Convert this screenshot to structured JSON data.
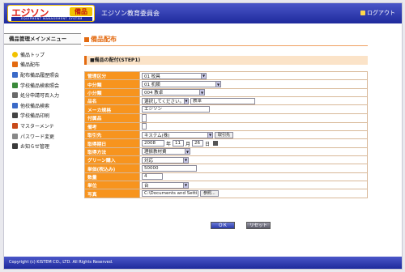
{
  "header": {
    "logo_text": "エジソン",
    "logo_badge": "備品",
    "logo_sub": "EQUIPMENT MANAGEMENT SYSTEM",
    "org_title": "エジソン教育委員会",
    "logout_label": "ログアウト"
  },
  "sidebar": {
    "title": "備品管理メインメニュー",
    "items": [
      {
        "label": "備品トップ",
        "icon": "star-icon",
        "color": "#f2c200"
      },
      {
        "label": "備品配布",
        "icon": "box-icon",
        "color": "#e36a10"
      },
      {
        "label": "配布備品履歴照会",
        "icon": "history-icon",
        "color": "#3a6ac8"
      },
      {
        "label": "学校備品検索照会",
        "icon": "search-icon",
        "color": "#3a8a3a"
      },
      {
        "label": "処分申請可否入力",
        "icon": "document-icon",
        "color": "#6a6a6a"
      },
      {
        "label": "他校備品検索",
        "icon": "search-icon",
        "color": "#3a6ac8"
      },
      {
        "label": "学校備品印刷",
        "icon": "printer-icon",
        "color": "#444444"
      },
      {
        "label": "マスターメンテ",
        "icon": "gear-icon",
        "color": "#c84a1a"
      },
      {
        "label": "パスワード変更",
        "icon": "lock-icon",
        "color": "#888888"
      },
      {
        "label": "お知らせ管理",
        "icon": "pencil-icon",
        "color": "#3a3a3a"
      }
    ]
  },
  "main": {
    "page_title": "備品配布",
    "step_label": "■備品の配付(STEP1)",
    "fields": {
      "category_mgmt": {
        "label": "管理区分",
        "value": "01 校具"
      },
      "category_mid": {
        "label": "中分類",
        "value": "01 机類"
      },
      "category_small": {
        "label": "小分類",
        "value": "004 教卓"
      },
      "item_name": {
        "label": "品名",
        "select": "選択してください。",
        "value": "教卓"
      },
      "maker": {
        "label": "メーカ規格",
        "value": "エジソン"
      },
      "accessories": {
        "label": "付属品",
        "value": ""
      },
      "notes": {
        "label": "備考",
        "value": ""
      },
      "supplier": {
        "label": "取引先",
        "value": "キステム(株)",
        "button": "取引先"
      },
      "acq_date": {
        "label": "取得期日",
        "year": "2008",
        "year_unit": "年",
        "month": "11",
        "month_unit": "月",
        "day": "26",
        "day_unit": "日"
      },
      "acq_method": {
        "label": "取得方法",
        "value": "理振教材費"
      },
      "green": {
        "label": "グリーン購入",
        "value": "対応"
      },
      "unit_price": {
        "label": "単価(税込み)",
        "value": "50000"
      },
      "quantity": {
        "label": "数量",
        "value": "4"
      },
      "unit": {
        "label": "単位",
        "value": "台"
      },
      "photo": {
        "label": "写真",
        "value": "C:\\Documents and Settin",
        "button": "参照..."
      }
    },
    "ok_label": "ＯＫ",
    "reset_label": "リセット"
  },
  "footer": {
    "copyright": "Copyright (c) KISTEM CO., LTD. All Rights Reserved."
  }
}
